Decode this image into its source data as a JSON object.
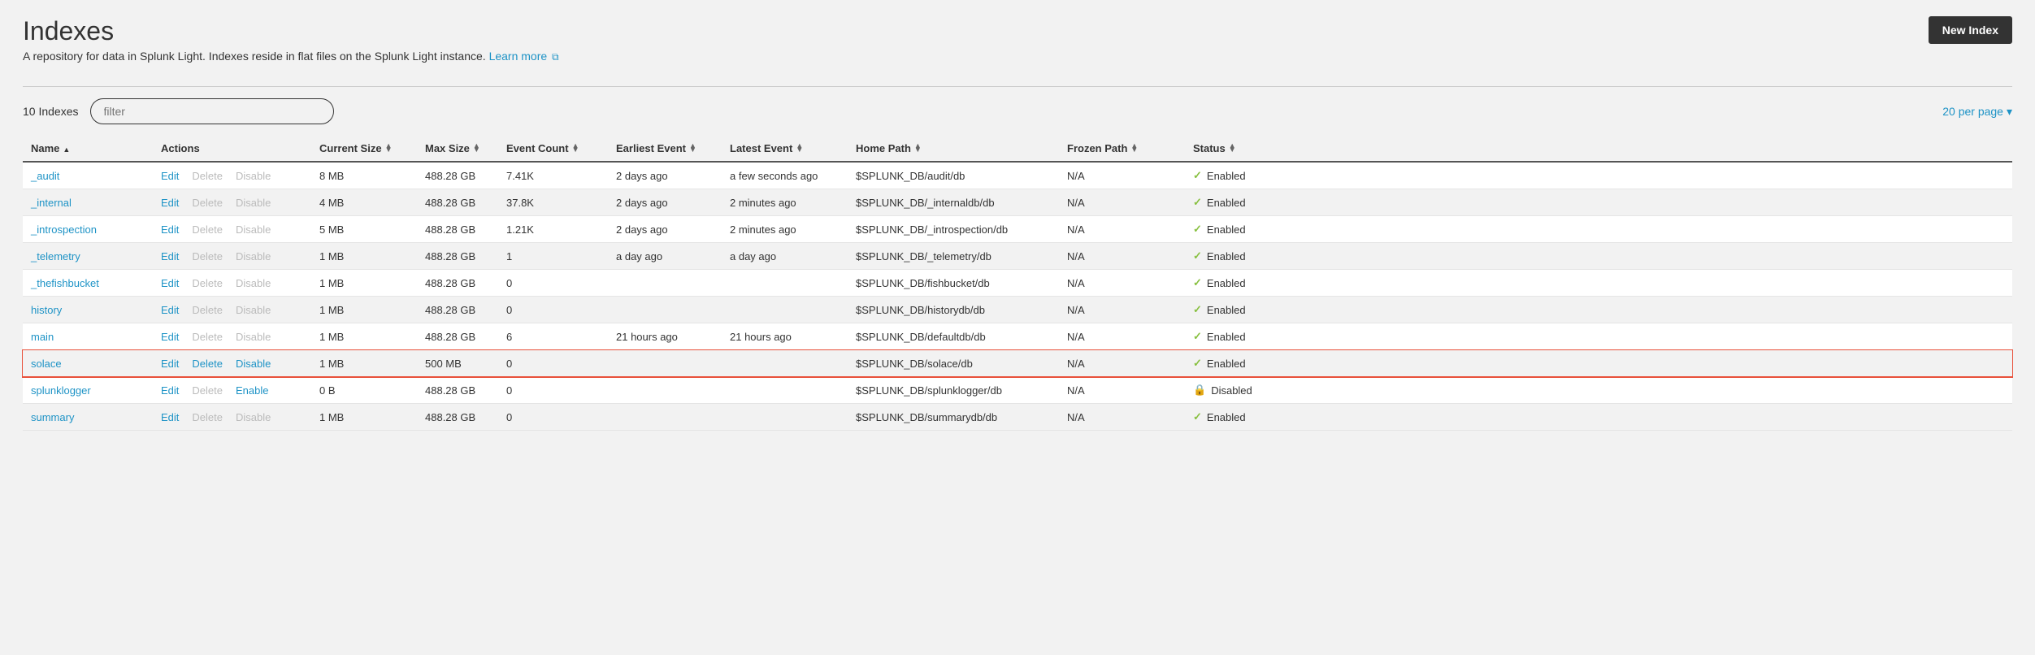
{
  "header": {
    "title": "Indexes",
    "description": "A repository for data in Splunk Light. Indexes reside in flat files on the Splunk Light instance. ",
    "learn_more": "Learn more",
    "new_button": "New Index"
  },
  "toolbar": {
    "count_label": "10 Indexes",
    "filter_placeholder": "filter",
    "per_page_label": "20 per page"
  },
  "columns": {
    "name": "Name",
    "actions": "Actions",
    "current_size": "Current Size",
    "max_size": "Max Size",
    "event_count": "Event Count",
    "earliest": "Earliest Event",
    "latest": "Latest Event",
    "home_path": "Home Path",
    "frozen_path": "Frozen Path",
    "status": "Status"
  },
  "actions": {
    "edit": "Edit",
    "delete": "Delete",
    "disable": "Disable",
    "enable": "Enable"
  },
  "status_labels": {
    "enabled": "Enabled",
    "disabled": "Disabled"
  },
  "rows": [
    {
      "name": "_audit",
      "delete_active": false,
      "toggle": "disable",
      "toggle_active": false,
      "current_size": "8 MB",
      "max_size": "488.28 GB",
      "event_count": "7.41K",
      "earliest": "2 days ago",
      "latest": "a few seconds ago",
      "home": "$SPLUNK_DB/audit/db",
      "frozen": "N/A",
      "status": "enabled",
      "highlight": false
    },
    {
      "name": "_internal",
      "delete_active": false,
      "toggle": "disable",
      "toggle_active": false,
      "current_size": "4 MB",
      "max_size": "488.28 GB",
      "event_count": "37.8K",
      "earliest": "2 days ago",
      "latest": "2 minutes ago",
      "home": "$SPLUNK_DB/_internaldb/db",
      "frozen": "N/A",
      "status": "enabled",
      "highlight": false
    },
    {
      "name": "_introspection",
      "delete_active": false,
      "toggle": "disable",
      "toggle_active": false,
      "current_size": "5 MB",
      "max_size": "488.28 GB",
      "event_count": "1.21K",
      "earliest": "2 days ago",
      "latest": "2 minutes ago",
      "home": "$SPLUNK_DB/_introspection/db",
      "frozen": "N/A",
      "status": "enabled",
      "highlight": false
    },
    {
      "name": "_telemetry",
      "delete_active": false,
      "toggle": "disable",
      "toggle_active": false,
      "current_size": "1 MB",
      "max_size": "488.28 GB",
      "event_count": "1",
      "earliest": "a day ago",
      "latest": "a day ago",
      "home": "$SPLUNK_DB/_telemetry/db",
      "frozen": "N/A",
      "status": "enabled",
      "highlight": false
    },
    {
      "name": "_thefishbucket",
      "delete_active": false,
      "toggle": "disable",
      "toggle_active": false,
      "current_size": "1 MB",
      "max_size": "488.28 GB",
      "event_count": "0",
      "earliest": "",
      "latest": "",
      "home": "$SPLUNK_DB/fishbucket/db",
      "frozen": "N/A",
      "status": "enabled",
      "highlight": false
    },
    {
      "name": "history",
      "delete_active": false,
      "toggle": "disable",
      "toggle_active": false,
      "current_size": "1 MB",
      "max_size": "488.28 GB",
      "event_count": "0",
      "earliest": "",
      "latest": "",
      "home": "$SPLUNK_DB/historydb/db",
      "frozen": "N/A",
      "status": "enabled",
      "highlight": false
    },
    {
      "name": "main",
      "delete_active": false,
      "toggle": "disable",
      "toggle_active": false,
      "current_size": "1 MB",
      "max_size": "488.28 GB",
      "event_count": "6",
      "earliest": "21 hours ago",
      "latest": "21 hours ago",
      "home": "$SPLUNK_DB/defaultdb/db",
      "frozen": "N/A",
      "status": "enabled",
      "highlight": false
    },
    {
      "name": "solace",
      "delete_active": true,
      "toggle": "disable",
      "toggle_active": true,
      "current_size": "1 MB",
      "max_size": "500 MB",
      "event_count": "0",
      "earliest": "",
      "latest": "",
      "home": "$SPLUNK_DB/solace/db",
      "frozen": "N/A",
      "status": "enabled",
      "highlight": true
    },
    {
      "name": "splunklogger",
      "delete_active": false,
      "toggle": "enable",
      "toggle_active": true,
      "current_size": "0 B",
      "max_size": "488.28 GB",
      "event_count": "0",
      "earliest": "",
      "latest": "",
      "home": "$SPLUNK_DB/splunklogger/db",
      "frozen": "N/A",
      "status": "disabled",
      "highlight": false
    },
    {
      "name": "summary",
      "delete_active": false,
      "toggle": "disable",
      "toggle_active": false,
      "current_size": "1 MB",
      "max_size": "488.28 GB",
      "event_count": "0",
      "earliest": "",
      "latest": "",
      "home": "$SPLUNK_DB/summarydb/db",
      "frozen": "N/A",
      "status": "enabled",
      "highlight": false
    }
  ]
}
